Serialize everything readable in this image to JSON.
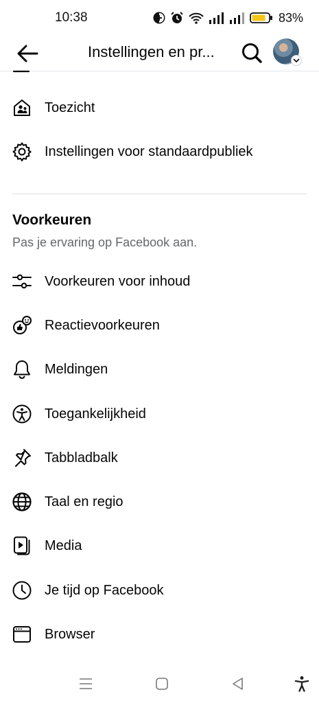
{
  "status_bar": {
    "time": "10:38",
    "battery_percent": "83%",
    "battery_level": 0.83,
    "battery_color": "#f5c518"
  },
  "header": {
    "title": "Instellingen en pr...",
    "back_icon": "arrow-left-icon",
    "search_icon": "search-icon",
    "avatar_icon": "profile-avatar"
  },
  "items_top": [
    {
      "label": "Toezicht",
      "icon": "supervision-house-icon"
    },
    {
      "label": "Instellingen voor standaardpubliek",
      "icon": "gear-icon"
    }
  ],
  "preferences": {
    "title": "Voorkeuren",
    "subtitle": "Pas je ervaring op Facebook aan.",
    "items": [
      {
        "label": "Voorkeuren voor inhoud",
        "icon": "sliders-icon"
      },
      {
        "label": "Reactievoorkeuren",
        "icon": "reactions-icon"
      },
      {
        "label": "Meldingen",
        "icon": "bell-icon"
      },
      {
        "label": "Toegankelijkheid",
        "icon": "accessibility-icon"
      },
      {
        "label": "Tabbladbalk",
        "icon": "pin-icon"
      },
      {
        "label": "Taal en regio",
        "icon": "globe-icon"
      },
      {
        "label": "Media",
        "icon": "media-play-icon"
      },
      {
        "label": "Je tijd op Facebook",
        "icon": "clock-icon"
      },
      {
        "label": "Browser",
        "icon": "browser-window-icon"
      }
    ]
  },
  "navbar": {
    "buttons": [
      "menu-icon",
      "home-square-icon",
      "back-triangle-icon",
      "accessibility-person-icon"
    ]
  },
  "colors": {
    "text": "#050505",
    "secondary_text": "#65676b",
    "divider": "#dadde1"
  }
}
